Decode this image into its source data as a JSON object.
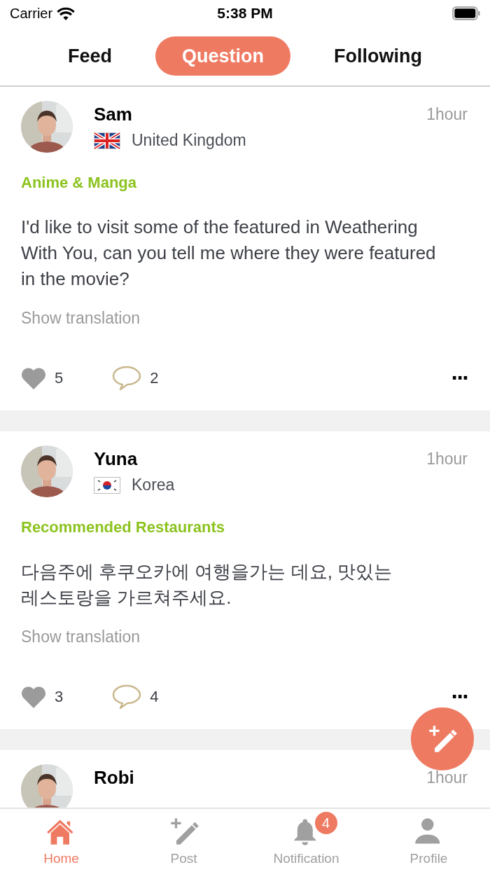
{
  "status_bar": {
    "carrier": "Carrier",
    "time": "5:38 PM"
  },
  "tabs": [
    {
      "label": "Feed",
      "selected": false
    },
    {
      "label": "Question",
      "selected": true
    },
    {
      "label": "Following",
      "selected": false
    }
  ],
  "posts": [
    {
      "name": "Sam",
      "flag": {
        "kind": "gb"
      },
      "country": "United Kingdom",
      "time": "1hour",
      "category": "Anime & Manga",
      "text": "I'd like to visit some of the featured in Weathering With You, can you tell me  where they were featured in the movie?",
      "translate": "Show translation",
      "likes": "5",
      "comments": "2",
      "more": "···"
    },
    {
      "name": "Yuna",
      "flag": {
        "kind": "kr"
      },
      "country": "Korea",
      "time": "1hour",
      "category": "Recommended Restaurants",
      "text": "다음주에 후쿠오카에 여행을가는 데요, 맛있는 레스토랑을 가르쳐주세요.",
      "translate": "Show translation",
      "likes": "3",
      "comments": "4",
      "more": "···"
    },
    {
      "name": "Robi",
      "time": "1hour"
    }
  ],
  "bottom_nav": [
    {
      "label": "Home",
      "kind": "home",
      "selected": true
    },
    {
      "label": "Post",
      "kind": "post",
      "selected": false
    },
    {
      "label": "Notification",
      "kind": "bell",
      "selected": false,
      "badge": "4"
    },
    {
      "label": "Profile",
      "kind": "person",
      "selected": false
    }
  ]
}
